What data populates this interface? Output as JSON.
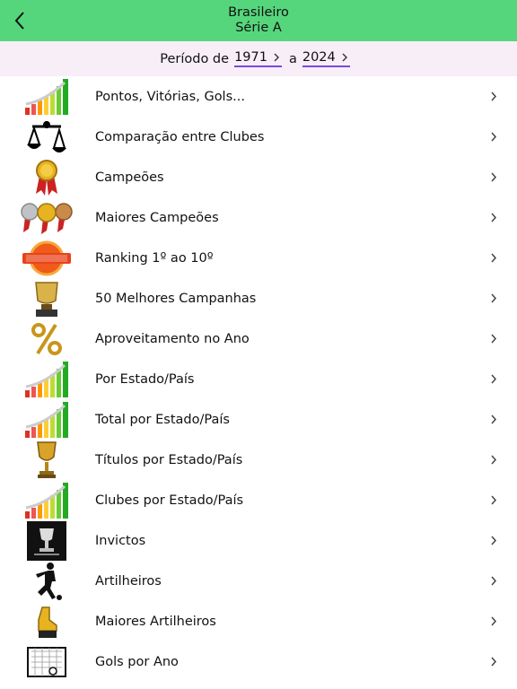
{
  "header": {
    "title_line1": "Brasileiro",
    "title_line2": "Série A"
  },
  "period": {
    "label": "Período de",
    "from": "1971",
    "separator": "a",
    "to": "2024"
  },
  "menu": [
    {
      "label": "Pontos, Vitórias, Gols...",
      "icon": "bar-chart-icon"
    },
    {
      "label": "Comparação entre Clubes",
      "icon": "balance-scale-icon"
    },
    {
      "label": "Campeões",
      "icon": "gold-medal-icon"
    },
    {
      "label": "Maiores Campeões",
      "icon": "medals-icon"
    },
    {
      "label": "Ranking 1º ao 10º",
      "icon": "ranking-badge-icon"
    },
    {
      "label": "50 Melhores Campanhas",
      "icon": "top-50-trophy-icon"
    },
    {
      "label": "Aproveitamento no Ano",
      "icon": "percent-icon"
    },
    {
      "label": "Por Estado/País",
      "icon": "bar-chart-icon"
    },
    {
      "label": "Total por Estado/País",
      "icon": "bar-chart-icon"
    },
    {
      "label": "Títulos por Estado/País",
      "icon": "trophy-cup-icon"
    },
    {
      "label": "Clubes por Estado/País",
      "icon": "bar-chart-icon"
    },
    {
      "label": "Invictos",
      "icon": "unbeaten-trophy-icon"
    },
    {
      "label": "Artilheiros",
      "icon": "soccer-player-icon"
    },
    {
      "label": "Maiores Artilheiros",
      "icon": "golden-boot-icon"
    },
    {
      "label": "Gols por Ano",
      "icon": "soccer-goal-icon"
    }
  ],
  "colors": {
    "header_bg": "#56d67c",
    "period_bg": "#f7eef8",
    "accent": "#7a4bd8"
  }
}
